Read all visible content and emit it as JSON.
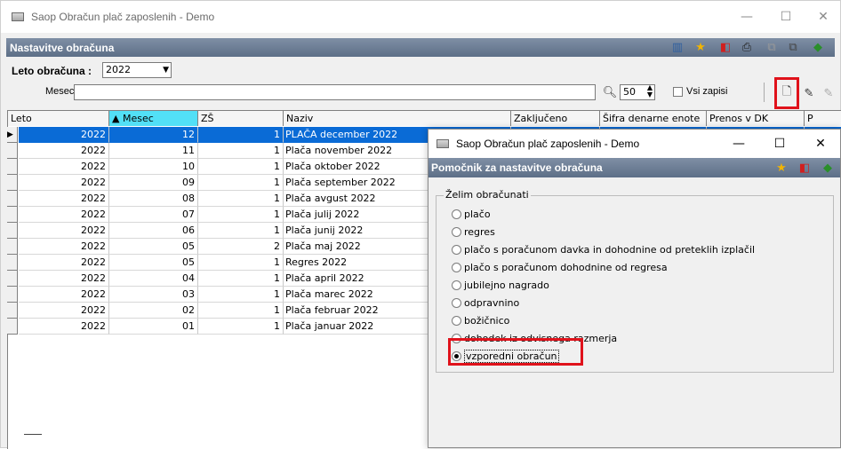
{
  "main_window": {
    "title": "Saop Obračun plač zaposlenih - Demo",
    "section_title": "Nastavitve obračuna",
    "controls": {
      "minimize": "—",
      "maximize": "☐",
      "close": "✕"
    }
  },
  "filters": {
    "year_label": "Leto obračuna :",
    "year_value": "2022",
    "month_label": "Mesec",
    "month_value": "",
    "page_size": "50",
    "all_records_label": "Vsi zapisi"
  },
  "grid": {
    "columns": [
      "Leto",
      "▲ Mesec",
      "ZŠ",
      "Naziv",
      "Zaključeno",
      "Šifra denarne enote",
      "Prenos v DK",
      "P"
    ],
    "rows": [
      {
        "leto": "2022",
        "mesec": "12",
        "zs": "1",
        "naziv": "PLAČA december 2022"
      },
      {
        "leto": "2022",
        "mesec": "11",
        "zs": "1",
        "naziv": "Plača november 2022"
      },
      {
        "leto": "2022",
        "mesec": "10",
        "zs": "1",
        "naziv": "Plača oktober 2022"
      },
      {
        "leto": "2022",
        "mesec": "09",
        "zs": "1",
        "naziv": "Plača september 2022"
      },
      {
        "leto": "2022",
        "mesec": "08",
        "zs": "1",
        "naziv": "Plača avgust 2022"
      },
      {
        "leto": "2022",
        "mesec": "07",
        "zs": "1",
        "naziv": "Plača julij 2022"
      },
      {
        "leto": "2022",
        "mesec": "06",
        "zs": "1",
        "naziv": "Plača junij 2022"
      },
      {
        "leto": "2022",
        "mesec": "05",
        "zs": "2",
        "naziv": "Plača maj 2022"
      },
      {
        "leto": "2022",
        "mesec": "05",
        "zs": "1",
        "naziv": "Regres 2022"
      },
      {
        "leto": "2022",
        "mesec": "04",
        "zs": "1",
        "naziv": "Plača april 2022"
      },
      {
        "leto": "2022",
        "mesec": "03",
        "zs": "1",
        "naziv": "Plača marec 2022"
      },
      {
        "leto": "2022",
        "mesec": "02",
        "zs": "1",
        "naziv": "Plača februar 2022"
      },
      {
        "leto": "2022",
        "mesec": "01",
        "zs": "1",
        "naziv": "Plača januar 2022"
      }
    ],
    "selected_row": 0
  },
  "dialog": {
    "title": "Saop Obračun plač zaposlenih - Demo",
    "section_title": "Pomočnik za nastavitve obračuna",
    "group_label": "Želim obračunati",
    "options": [
      "plačo",
      "regres",
      "plačo s poračunom davka in dohodnine od preteklih izplačil",
      "plačo s poračunom dohodnine od regresa",
      "jubilejno nagrado",
      "odpravnino",
      "božičnico",
      "dohodek iz odvisnega razmerja",
      "vzporedni obračun"
    ],
    "selected_option": 8,
    "controls": {
      "minimize": "—",
      "maximize": "☐",
      "close": "✕"
    }
  },
  "colors": {
    "title_bar": "#6f8099",
    "selection": "#0a6bd6",
    "sorted_header": "#52e0f6",
    "highlight_box": "#e0121b"
  }
}
